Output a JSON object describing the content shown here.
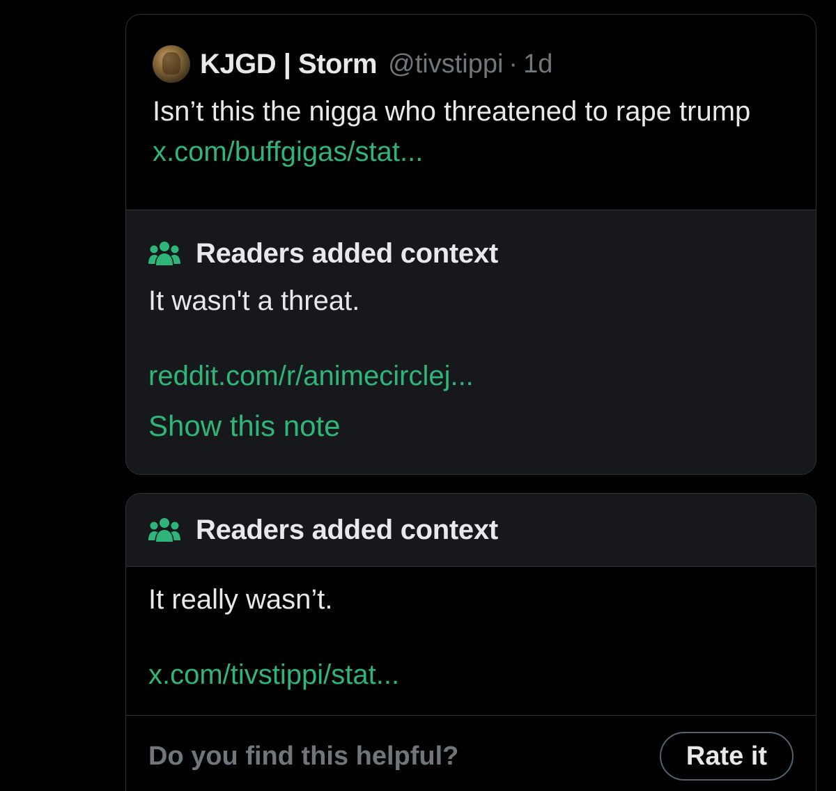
{
  "quoted_tweet": {
    "display_name": "KJGD | Storm",
    "handle": "@tivstippi",
    "separator": "·",
    "time": "1d",
    "text": "Isn’t this the nigga who threatened to rape trump",
    "link": "x.com/buffgigas/stat..."
  },
  "first_note": {
    "title": "Readers added context",
    "body": "It wasn't a threat.",
    "link": "reddit.com/r/animecirclej...",
    "show_note": "Show this note"
  },
  "second_note": {
    "title": "Readers added context",
    "body": "It really wasn’t.",
    "link": "x.com/tivstippi/stat...",
    "helpful_prompt": "Do you find this helpful?",
    "rate_label": "Rate it"
  },
  "colors": {
    "accent_green": "#2fb57a",
    "secondary_text": "#71767b",
    "note_bg": "#16181c",
    "border": "#2f3336"
  },
  "icons": {
    "note_header_icon": "people-icon"
  }
}
